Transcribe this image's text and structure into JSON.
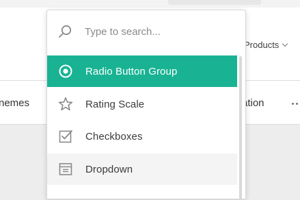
{
  "background": {
    "menu_right": "Products",
    "tab_left": "nemes",
    "tab_right": "ation"
  },
  "search": {
    "placeholder": "Type to search...",
    "value": ""
  },
  "items": [
    {
      "label": "Radio Button Group",
      "icon": "radio-icon",
      "state": "selected"
    },
    {
      "label": "Rating Scale",
      "icon": "star-icon",
      "state": "normal"
    },
    {
      "label": "Checkboxes",
      "icon": "checkbox-icon",
      "state": "normal"
    },
    {
      "label": "Dropdown",
      "icon": "dropdown-icon",
      "state": "hover"
    }
  ],
  "colors": {
    "accent": "#19b394",
    "scribble": "#d84a8a"
  }
}
